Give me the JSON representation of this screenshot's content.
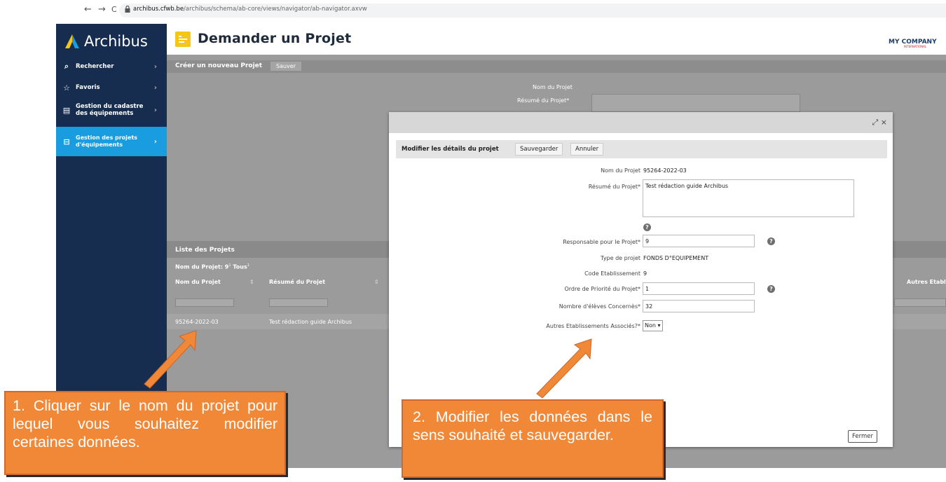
{
  "browser": {
    "url_domain": "archibus.cfwb.be",
    "url_path": "/archibus/schema/ab-core/views/navigator/ab-navigator.axvw",
    "back_icon": "←",
    "forward_icon": "→",
    "reload_icon": "C"
  },
  "app": {
    "name": "Archibus"
  },
  "sidebar": {
    "items": [
      {
        "label_1": "Rechercher",
        "label_2": "",
        "icon": "search-icon"
      },
      {
        "label_1": "Favoris",
        "label_2": "",
        "icon": "star-icon"
      },
      {
        "label_1": "Gestion du cadastre",
        "label_2": "des équipements",
        "icon": "document-icon"
      },
      {
        "label_1": "Gestion des projets",
        "label_2": "d'équipements",
        "icon": "projects-icon"
      }
    ],
    "chevron": "›"
  },
  "header": {
    "title": "Demander un Projet",
    "company": "MY COMPANY",
    "company_sub": "INTERNATIONAL"
  },
  "create_panel": {
    "title": "Créer un nouveau Projet",
    "save_label": "Sauver",
    "name_label": "Nom du Projet",
    "summary_label": "Résumé du Projet*"
  },
  "list_panel": {
    "title": "Liste des Projets",
    "filter_label": "Nom du Projet: 9",
    "filter_sup": "1",
    "filter_all": "Tous",
    "columns": [
      "Nom du Projet",
      "Résumé du Projet",
      "Autres Etabl"
    ],
    "rows": [
      {
        "name": "95264-2022-03",
        "summary": "Test rédaction guide Archibus"
      }
    ]
  },
  "modal": {
    "controls": "⤢ ×",
    "panel_title": "Modifier les détails du projet",
    "save_label": "Sauvegarder",
    "cancel_label": "Annuler",
    "close_label": "Fermer",
    "fields": {
      "name_label": "Nom du Projet",
      "name_value": "95264-2022-03",
      "summary_label": "Résumé du Projet*",
      "summary_value": "Test rédaction guide Archibus",
      "manager_label": "Responsable pour le Projet*",
      "manager_value": "9",
      "type_label": "Type de projet",
      "type_value": "FONDS D°EQUIPEMENT",
      "code_label": "Code Etablissement",
      "code_value": "9",
      "priority_label": "Ordre de Priorité du Projet*",
      "priority_value": "1",
      "students_label": "Nombre d'élèves Concernès*",
      "students_value": "32",
      "other_label": "Autres Etablissements Associés?*",
      "other_value": "Non"
    },
    "help_icon": "?"
  },
  "callouts": {
    "one": "1. Cliquer sur le nom du projet pour lequel vous souhaitez modifier certaines données.",
    "two": "2. Modifier les données dans le sens souhaité et sauvegarder."
  },
  "colors": {
    "sidebar": "#162d50",
    "active": "#1a9de0",
    "accent": "#f5c518",
    "callout": "#f08838"
  }
}
